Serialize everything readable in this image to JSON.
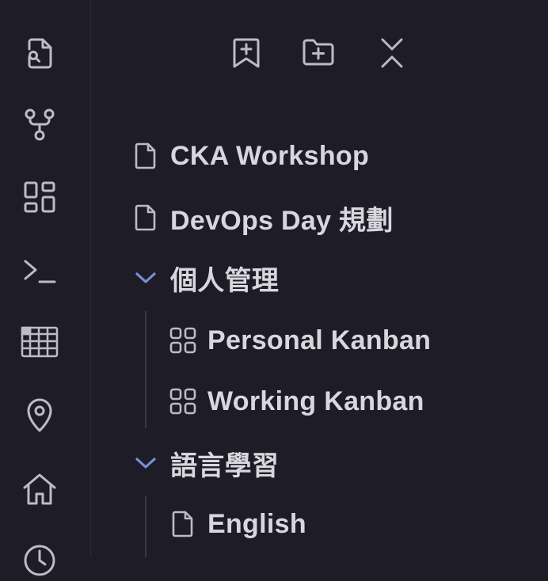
{
  "colors": {
    "background": "#1e1c27",
    "icon": "#bdbcc4",
    "text": "#d8d7dd",
    "accent": "#7b8fd6"
  },
  "ribbon": {
    "icons": [
      "search-file-icon",
      "git-graph-icon",
      "dashboard-grid-icon",
      "terminal-icon",
      "table-icon",
      "map-pin-icon",
      "home-icon",
      "clock-icon"
    ]
  },
  "toolbar": {
    "icons": [
      "new-note-icon",
      "new-folder-icon",
      "collapse-all-icon"
    ]
  },
  "tree": {
    "items": [
      {
        "type": "file",
        "label": "CKA Workshop"
      },
      {
        "type": "file",
        "label": "DevOps Day 規劃"
      },
      {
        "type": "folder",
        "label": "個人管理",
        "expanded": true
      },
      {
        "type": "kanban",
        "label": "Personal Kanban"
      },
      {
        "type": "kanban",
        "label": "Working Kanban"
      },
      {
        "type": "folder",
        "label": "語言學習",
        "expanded": true
      },
      {
        "type": "file",
        "label": "English"
      }
    ]
  }
}
